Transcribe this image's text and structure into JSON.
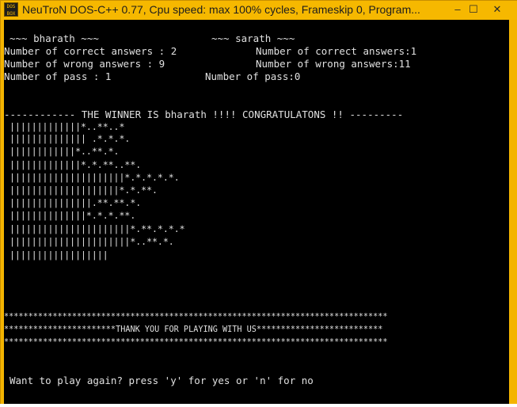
{
  "window": {
    "title": "NeuTroN DOS-C++ 0.77, Cpu speed: max 100% cycles, Frameskip  0, Program...",
    "icon_text": "DOS BOX",
    "minimize_glyph": "–",
    "maximize_glyph": "☐",
    "close_glyph": "✕"
  },
  "scores": {
    "player1_header": "~~~ bharath ~~~",
    "player2_header": "~~~ sarath ~~~",
    "player1_correct": "Number of correct answers : 2",
    "player2_correct": "Number of correct answers:1",
    "player1_wrong": "Number of wrong answers : 9",
    "player2_wrong": "Number of wrong answers:11",
    "player1_pass": "Number of pass : 1",
    "player2_pass": "Number of pass:0"
  },
  "winner_banner": "------------ THE WINNER IS bharath !!!! CONGRATULATONS !! ---------",
  "art_rows": [
    "|||||||||||||*..**..*",
    "|||||||||||||| .*.*.*.",
    "||||||||||||*..**.*.",
    "|||||||||||||*.*.**..**.",
    "|||||||||||||||||||||*.*.*.*.*.",
    "||||||||||||||||||||*.*.**.",
    "|||||||||||||||.**.**.*.",
    "||||||||||||||*.*.*.**.",
    "||||||||||||||||||||||*.**.*.*.*",
    "||||||||||||||||||||||*..**.*.",
    "||||||||||||||||||"
  ],
  "thanks": {
    "border_top": "*******************************************************************************",
    "message": "***********************THANK YOU FOR PLAYING WITH US**************************",
    "border_bottom": "*******************************************************************************"
  },
  "prompt": "Want to play again? press 'y' for yes or 'n' for no",
  "colors": {
    "title_bar": "#f6b800",
    "terminal_bg": "#000000",
    "terminal_fg": "#e0e0e0"
  }
}
